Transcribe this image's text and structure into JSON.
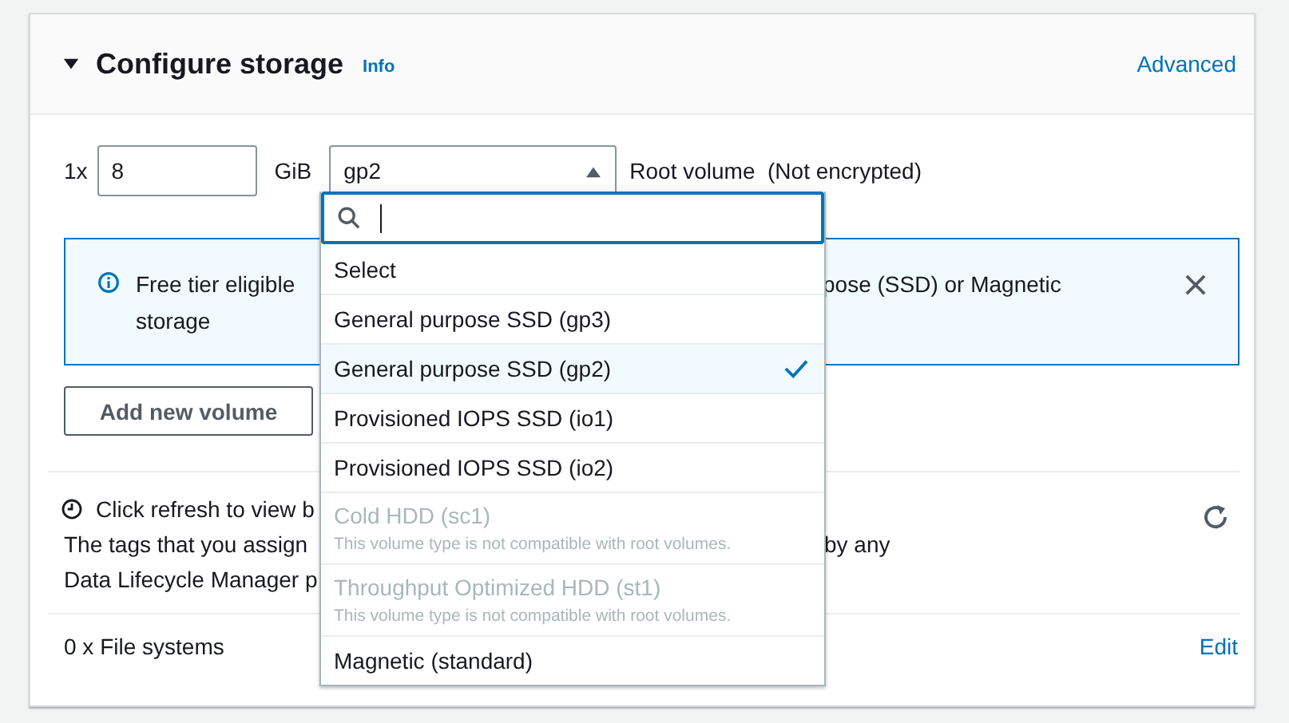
{
  "section": {
    "title": "Configure storage",
    "expanded": true,
    "info_link": "Info",
    "advanced_link": "Advanced"
  },
  "volume": {
    "count_label": "1x",
    "size": "8",
    "unit": "GiB",
    "type_value": "gp2",
    "description": "Root volume  (Not encrypted)"
  },
  "alert": {
    "line_1_left": "Free tier eligible",
    "line_1_right": "pose (SSD) or Magnetic",
    "line_2": "storage"
  },
  "add_volume_button": "Add new volume",
  "backup": {
    "title_left": "Click refresh to view b",
    "line_1_left": "The tags that you assign",
    "line_1_right": "by any",
    "line_2_left": "Data Lifecycle Manager p"
  },
  "file_systems": {
    "label": "0 x File systems",
    "edit_link": "Edit"
  },
  "dropdown": {
    "open": true,
    "options": [
      {
        "label": "Select",
        "selected": false,
        "disabled": false
      },
      {
        "label": "General purpose SSD (gp3)",
        "selected": false,
        "disabled": false
      },
      {
        "label": "General purpose SSD (gp2)",
        "selected": true,
        "disabled": false
      },
      {
        "label": "Provisioned IOPS SSD (io1)",
        "selected": false,
        "disabled": false
      },
      {
        "label": "Provisioned IOPS SSD (io2)",
        "selected": false,
        "disabled": false
      },
      {
        "label": "Cold HDD (sc1)",
        "selected": false,
        "disabled": true,
        "description": "This volume type is not compatible with root volumes."
      },
      {
        "label": "Throughput Optimized HDD (st1)",
        "selected": false,
        "disabled": true,
        "description": "This volume type is not compatible with root volumes."
      },
      {
        "label": "Magnetic (standard)",
        "selected": false,
        "disabled": false
      }
    ]
  }
}
